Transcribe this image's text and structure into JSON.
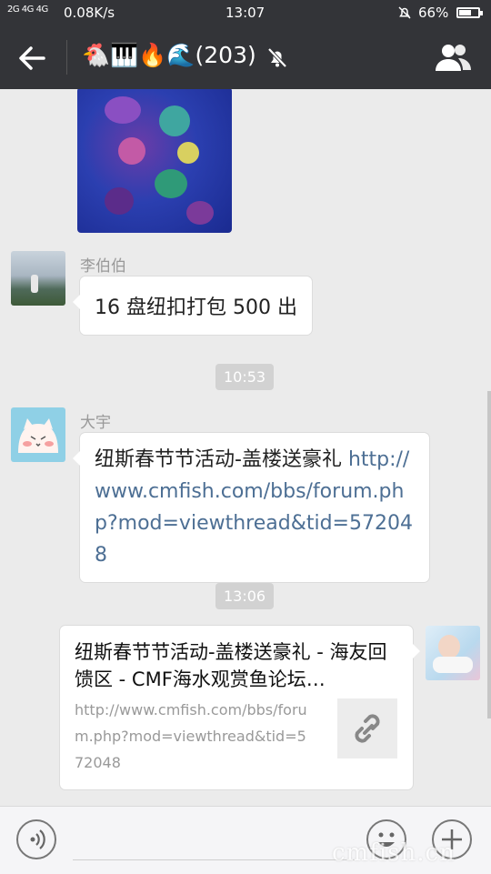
{
  "status_bar": {
    "signal": "2G 4G 4G",
    "speed": "0.08K/s",
    "time": "13:07",
    "battery": "66%",
    "battery_level": 0.66
  },
  "header": {
    "title": "🐔🎹🔥🌊(203)",
    "back_icon": "back-arrow-icon",
    "mute_icon": "bell-off-icon",
    "members_icon": "group-members-icon",
    "bg_color": "#333438"
  },
  "messages": [
    {
      "type": "image",
      "side": "left",
      "description": "aquarium-photo"
    },
    {
      "type": "text",
      "side": "left",
      "sender": "李伯伯",
      "text": "16 盘纽扣打包 500 出"
    },
    {
      "type": "time",
      "text": "10:53"
    },
    {
      "type": "text-link",
      "side": "left",
      "sender": "大宇",
      "text": "纽斯春节节活动-盖楼送豪礼 ",
      "link": "http://www.cmfish.com/bbs/forum.php?mod=viewthread&tid=572048"
    },
    {
      "type": "time",
      "text": "13:06"
    },
    {
      "type": "share",
      "side": "right",
      "title": "纽斯春节节活动-盖楼送豪礼 - 海友回馈区 - CMF海水观赏鱼论坛…",
      "url": "http://www.cmfish.com/bbs/forum.php?mod=viewthread&tid=572048",
      "icon": "link-icon"
    }
  ],
  "input_bar": {
    "voice_icon": "voice-icon",
    "emoji_icon": "emoji-icon",
    "plus_icon": "plus-icon",
    "watermark": "cmfish.cn"
  },
  "colors": {
    "link": "#4d6f94",
    "chat_bg": "#ebebeb",
    "bubble": "#ffffff",
    "time_tag": "#d2d2d2"
  }
}
